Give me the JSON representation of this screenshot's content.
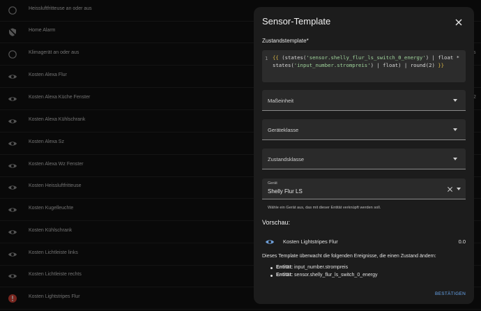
{
  "entities": [
    {
      "label": "Heissluftfritteuse an oder aus",
      "icon": "circle-outline-icon"
    },
    {
      "label": "Home Alarm",
      "icon": "shield-off-icon"
    },
    {
      "label": "Klimagerät an oder aus",
      "icon": "circle-outline-icon"
    },
    {
      "label": "Kosten Alexa Flur",
      "icon": "eye-icon"
    },
    {
      "label": "Kosten Alexa Küche Fenster",
      "icon": "eye-icon"
    },
    {
      "label": "Kosten Alexa Kühlschrank",
      "icon": "eye-icon"
    },
    {
      "label": "Kosten Alexa Sz",
      "icon": "eye-icon"
    },
    {
      "label": "Kosten Alexa Wz Fenster",
      "icon": "eye-icon"
    },
    {
      "label": "Kosten Heissluftfritteuse",
      "icon": "eye-icon"
    },
    {
      "label": "Kosten Kugelleuchte",
      "icon": "eye-icon"
    },
    {
      "label": "Kosten Kühlschrank",
      "icon": "eye-icon"
    },
    {
      "label": "Kosten Lichtleiste links",
      "icon": "eye-icon"
    },
    {
      "label": "Kosten Lichtleiste rechts",
      "icon": "eye-icon"
    },
    {
      "label": "Kosten Lightstripes Flur",
      "icon": "alert-circle-icon"
    }
  ],
  "side_text": {
    "row2": "s",
    "row4": "2"
  },
  "dialog": {
    "title": "Sensor-Template",
    "state_template_label": "Zustandstemplate*",
    "code_line_number": "1",
    "code_parts": [
      "{{",
      " (states(",
      "'sensor.shelly_flur_ls_switch_0_energy'",
      ") | float * states(",
      "'input_number.strompreis'",
      ") | float) | round(2) ",
      "}}"
    ],
    "unit_label": "Maßeinheit",
    "device_class_label": "Geräteklasse",
    "state_class_label": "Zustandsklasse",
    "device_label": "Gerät",
    "device_value": "Shelly Flur LS",
    "device_helper": "Wähle ein Gerät aus, das mit dieser Entität verknüpft werden soll.",
    "preview_heading": "Vorschau:",
    "preview_name": "Kosten Lightstripes Flur",
    "preview_value": "0.0",
    "tracking_text": "Dieses Template überwacht die folgenden Ereignisse, die einen Zustand ändern:",
    "tracked": [
      {
        "kind": "Entität:",
        "value": " input_number.strompreis"
      },
      {
        "kind": "Entität:",
        "value": " sensor.shelly_flur_ls_switch_0_energy"
      }
    ],
    "confirm_label": "BESTÄTIGEN"
  },
  "colors": {
    "accent": "#6aa9f2",
    "alert": "#db4437",
    "eye": "#6f9fd8"
  }
}
